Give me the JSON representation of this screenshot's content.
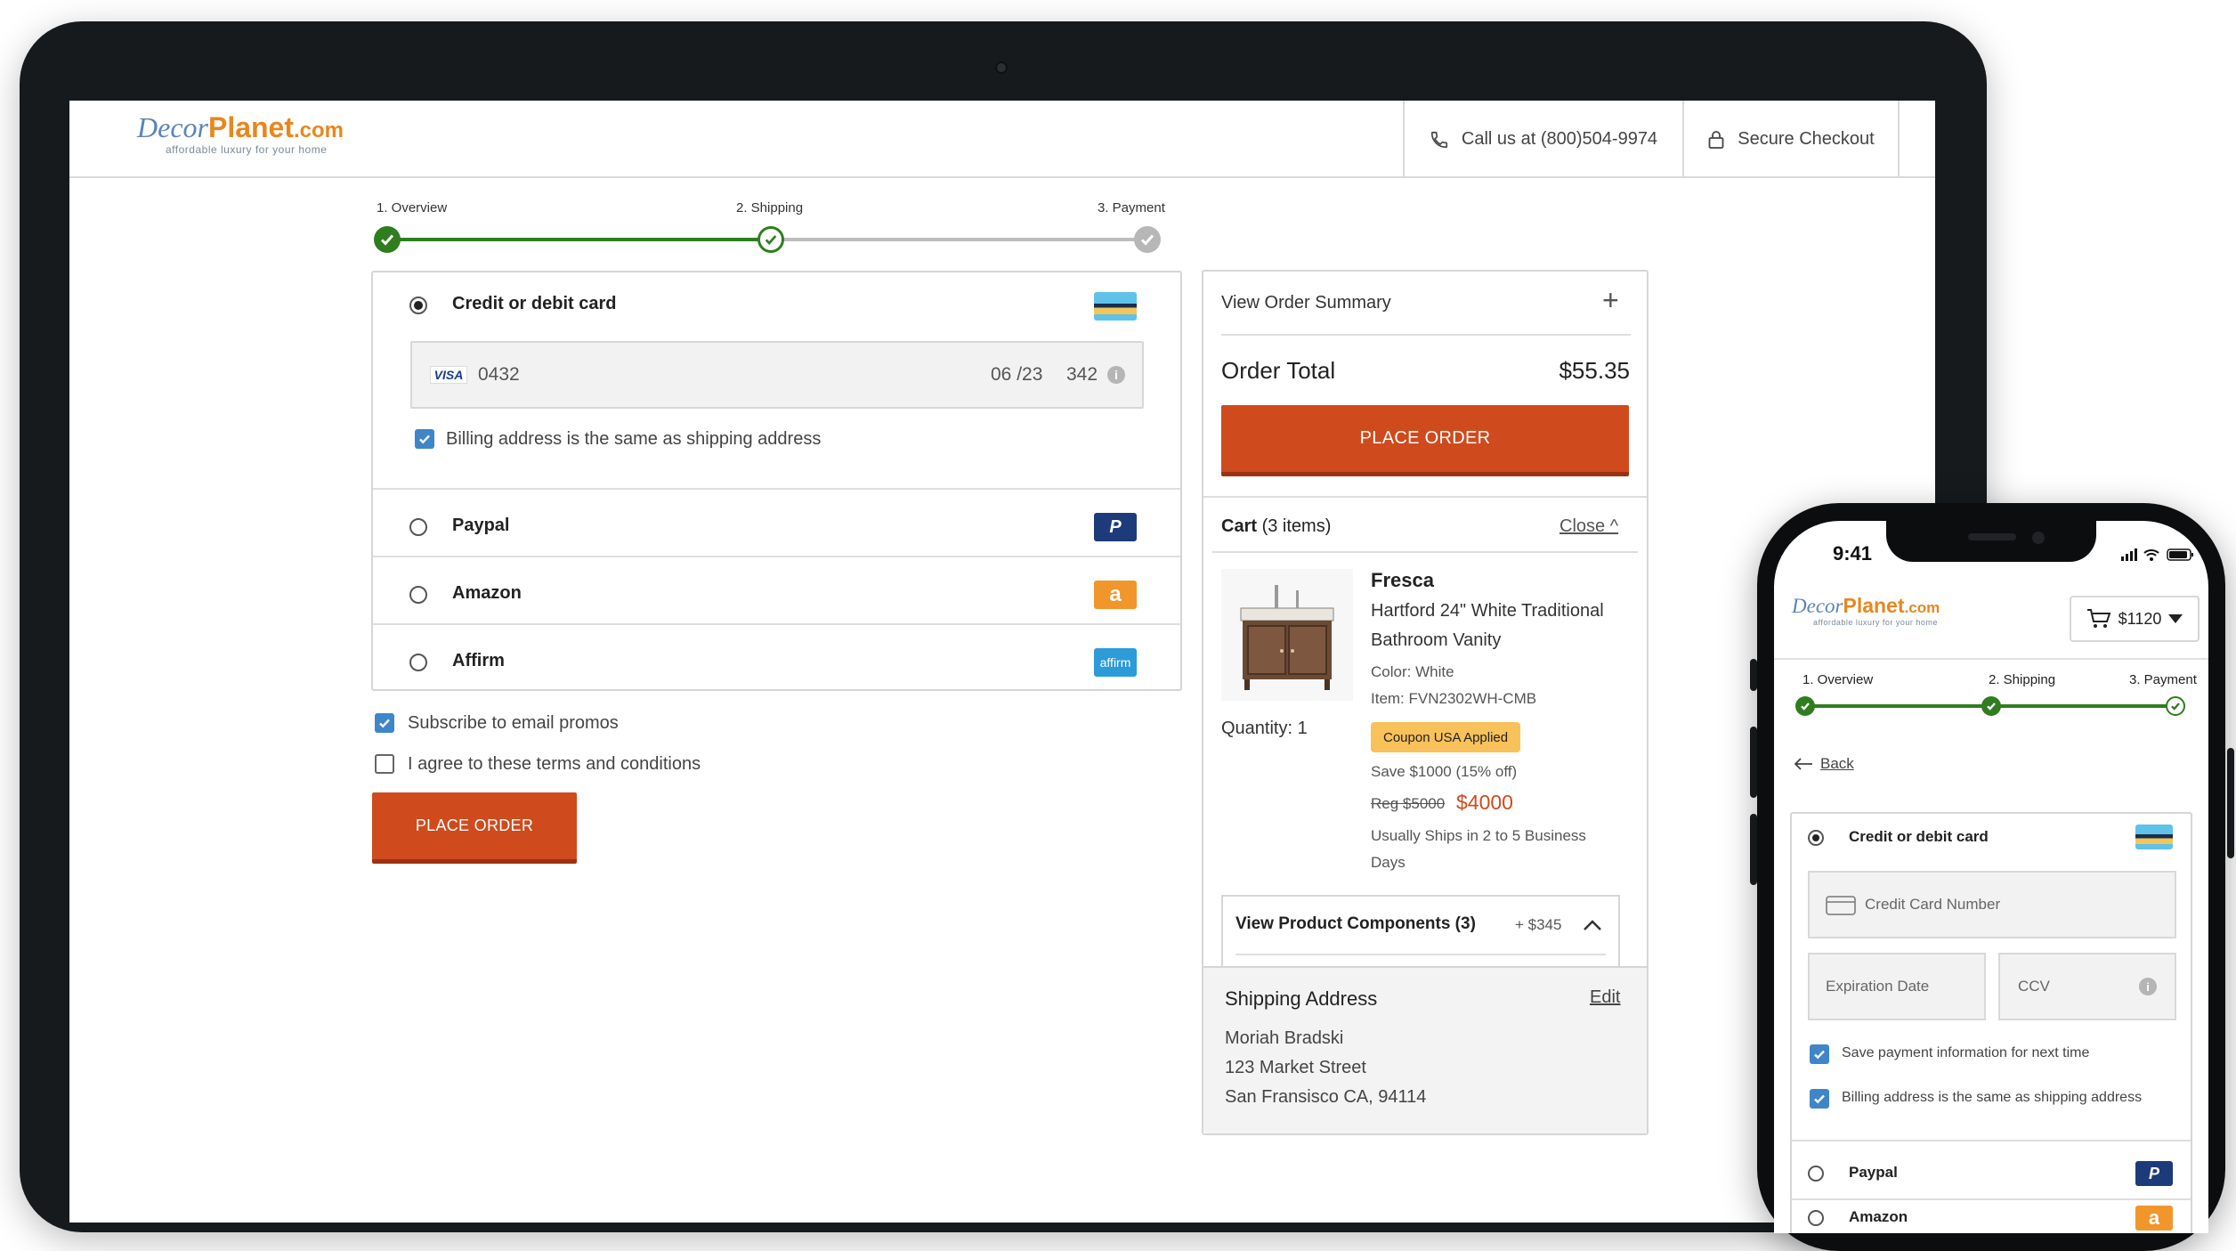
{
  "brand": {
    "decor": "Decor",
    "planet": "Planet",
    "com": ".com",
    "tagline": "affordable luxury for your home"
  },
  "header": {
    "phone": "Call us at (800)504-9974",
    "secure": "Secure Checkout"
  },
  "steps": {
    "overview": "1. Overview",
    "shipping": "2. Shipping",
    "payment": "3. Payment"
  },
  "payment": {
    "credit": {
      "label": "Credit or debit card",
      "card_brand": "VISA",
      "number": "0432",
      "expiry": "06 /23",
      "cvv": "342"
    },
    "billing_same": "Billing address is the same as shipping address",
    "paypal": "Paypal",
    "amazon": "Amazon",
    "affirm": "Affirm",
    "affirm_logo": "affirm",
    "amazon_logo": "a",
    "paypal_logo": "P"
  },
  "agreements": {
    "subscribe": "Subscribe to email promos",
    "terms": "I agree to these terms and conditions"
  },
  "place_order": "PLACE ORDER",
  "summary": {
    "view_summary": "View Order Summary",
    "plus": "+",
    "order_total_label": "Order Total",
    "order_total_value": "$55.35",
    "place_order": "PLACE ORDER",
    "cart_label": "Cart",
    "cart_count": " (3 items)",
    "close": "Close ^",
    "product": {
      "brand": "Fresca",
      "name_line1": "Hartford 24\" White Traditional",
      "name_line2": "Bathroom Vanity",
      "color": "Color: White",
      "item": "Item: FVN2302WH-CMB",
      "coupon": "Coupon USA Applied",
      "save": "Save $1000 (15% off)",
      "reg": "Reg $5000",
      "price": "$4000",
      "ships_line1": "Usually Ships in 2 to 5 Business",
      "ships_line2": "Days",
      "quantity": "Quantity: 1"
    },
    "components": {
      "label": "View Product Components (3)",
      "price": "+ $345"
    },
    "shipping": {
      "title": "Shipping Address",
      "edit": "Edit",
      "name": "Moriah Bradski",
      "street": "123 Market Street",
      "city": "San Fransisco CA, 94114"
    }
  },
  "mobile": {
    "time": "9:41",
    "cart_total": "$1120",
    "back": "Back",
    "steps": {
      "overview": "1. Overview",
      "shipping": "2. Shipping",
      "payment": "3. Payment"
    },
    "credit_label": "Credit or debit card",
    "card_number_placeholder": "Credit Card Number",
    "expiration_placeholder": "Expiration Date",
    "ccv_placeholder": "CCV",
    "save_payment": "Save payment information for next time",
    "billing_same": "Billing address is the same as shipping address",
    "paypal": "Paypal",
    "amazon": "Amazon"
  },
  "colors": {
    "accent_orange": "#cf4a1c",
    "progress_green": "#2f7d1f",
    "checkbox_blue": "#3f86c9",
    "brand_blue": "#5b83b8",
    "brand_orange": "#e8871e"
  }
}
